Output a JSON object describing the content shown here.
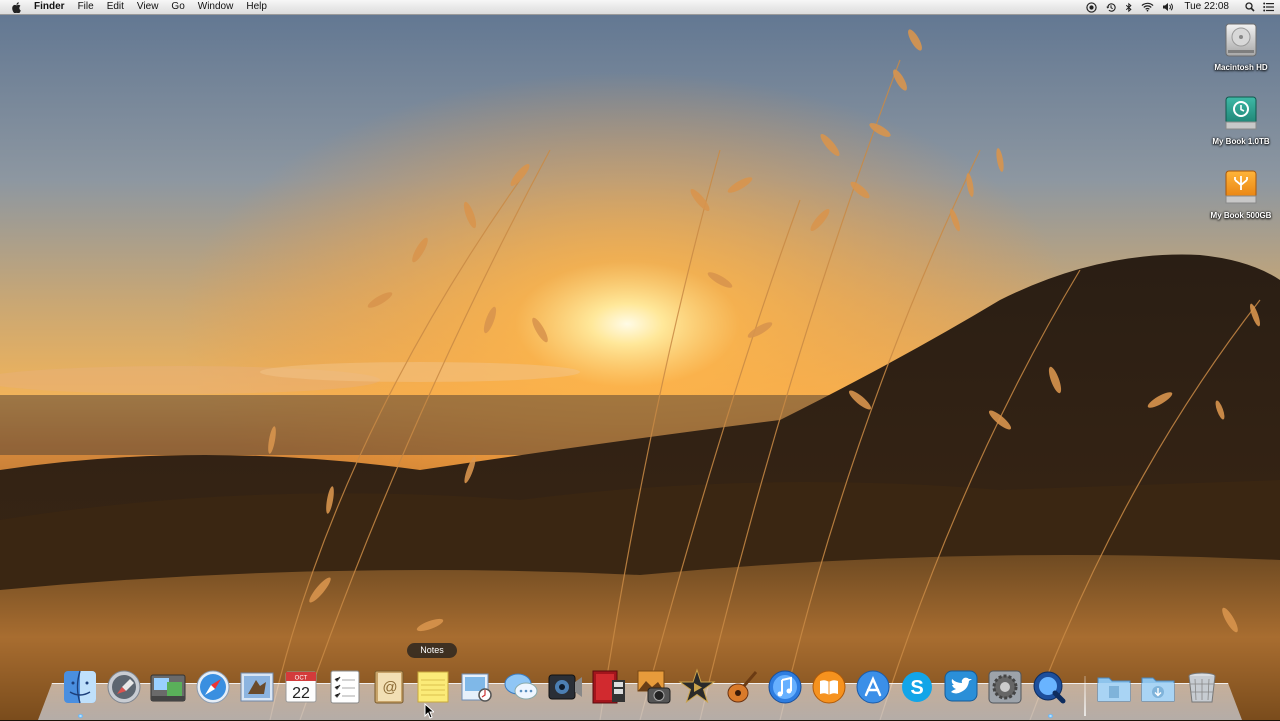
{
  "menubar": {
    "app_name": "Finder",
    "menus": [
      "File",
      "Edit",
      "View",
      "Go",
      "Window",
      "Help"
    ],
    "clock": "Tue 22:08"
  },
  "desktop_icons": [
    {
      "label": "Macintosh HD",
      "icon": "internal-drive-icon"
    },
    {
      "label": "My Book 1.0TB",
      "icon": "time-machine-drive-icon"
    },
    {
      "label": "My Book 500GB",
      "icon": "firewire-drive-icon"
    }
  ],
  "dock": {
    "tooltip": "Notes",
    "hovered_app": "Notes",
    "calendar_month": "OCT",
    "calendar_day": "22",
    "apps": [
      "Finder",
      "Launchpad",
      "Image Capture",
      "Safari",
      "Mail",
      "Calendar",
      "Reminders",
      "Contacts",
      "Notes",
      "Preview",
      "Messages",
      "FaceTime",
      "Photo Booth",
      "iPhoto",
      "iMovie",
      "GarageBand",
      "iTunes",
      "iBooks",
      "App Store",
      "Skype",
      "Twitter",
      "System Preferences",
      "QuickTime Player",
      "Applications",
      "Downloads",
      "Trash"
    ]
  },
  "colors": {
    "menubar_bg": "#e9e9e9",
    "sky_top": "#6b7f98",
    "sun": "#fff4c8",
    "grass": "#b07532"
  }
}
